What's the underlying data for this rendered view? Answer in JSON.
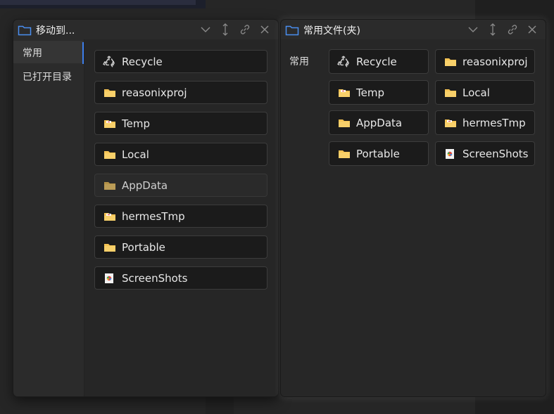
{
  "left_panel": {
    "title": "移动到...",
    "sidebar": [
      {
        "label": "常用",
        "active": true
      },
      {
        "label": "已打开目录",
        "active": false
      }
    ],
    "items": [
      {
        "label": "Recycle",
        "icon": "recycle-icon"
      },
      {
        "label": "reasonixproj",
        "icon": "folder-icon"
      },
      {
        "label": "Temp",
        "icon": "folder-doc-icon"
      },
      {
        "label": "Local",
        "icon": "folder-icon"
      },
      {
        "label": "AppData",
        "icon": "folder-icon"
      },
      {
        "label": "hermesTmp",
        "icon": "folder-doc-icon"
      },
      {
        "label": "Portable",
        "icon": "folder-icon"
      },
      {
        "label": "ScreenShots",
        "icon": "screenshots-icon"
      }
    ]
  },
  "right_panel": {
    "title": "常用文件(夹)",
    "section_label": "常用",
    "items": [
      {
        "label": "Recycle",
        "icon": "recycle-icon"
      },
      {
        "label": "reasonixproj",
        "icon": "folder-icon"
      },
      {
        "label": "Temp",
        "icon": "folder-doc-icon"
      },
      {
        "label": "Local",
        "icon": "folder-icon"
      },
      {
        "label": "AppData",
        "icon": "folder-icon"
      },
      {
        "label": "hermesTmp",
        "icon": "folder-doc-icon"
      },
      {
        "label": "Portable",
        "icon": "folder-icon"
      },
      {
        "label": "ScreenShots",
        "icon": "screenshots-icon"
      }
    ]
  },
  "colors": {
    "accent": "#3d7eea",
    "folder": "#f5c354",
    "panel_bg": "#2b2b2b",
    "card_bg": "#1b1b1b"
  }
}
